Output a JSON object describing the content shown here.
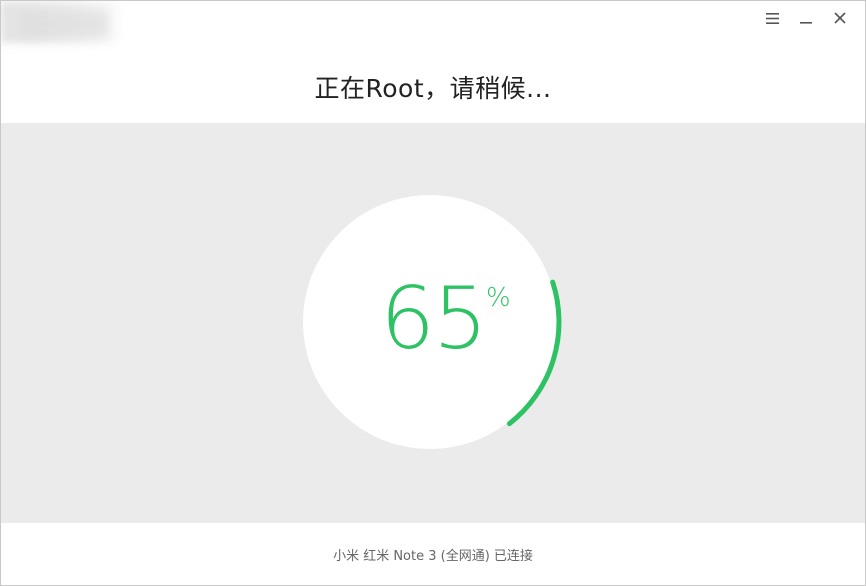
{
  "window": {
    "title": "正在Root，请稍候..."
  },
  "controls": {
    "menu_icon": "menu-icon",
    "minimize_icon": "minimize-icon",
    "close_icon": "close-icon"
  },
  "progress": {
    "value": 65,
    "value_text": "65",
    "unit": "%"
  },
  "footer": {
    "status": "小米 红米 Note 3 (全网通) 已连接"
  },
  "colors": {
    "accent": "#2ec264",
    "content_bg": "#ebebeb",
    "circle_bg": "#ffffff"
  }
}
